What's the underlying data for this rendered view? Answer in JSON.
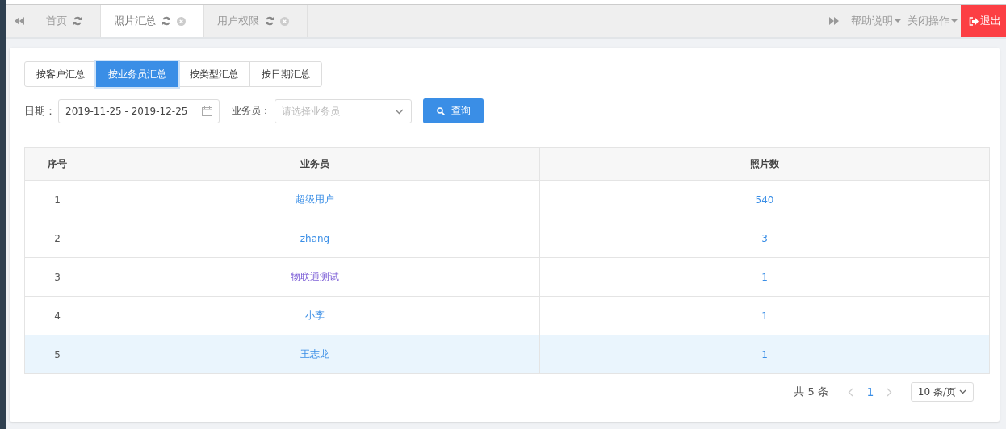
{
  "tabs": [
    {
      "label": "首页",
      "selected": false,
      "closable": false
    },
    {
      "label": "照片汇总",
      "selected": true,
      "closable": true
    },
    {
      "label": "用户权限",
      "selected": false,
      "closable": true
    }
  ],
  "top_actions": [
    {
      "label": "帮助说明"
    },
    {
      "label": "关闭操作"
    }
  ],
  "logout": "退出",
  "group_buttons": [
    {
      "label": "按客户汇总",
      "selected": false
    },
    {
      "label": "按业务员汇总",
      "selected": true
    },
    {
      "label": "按类型汇总",
      "selected": false
    },
    {
      "label": "按日期汇总",
      "selected": false
    }
  ],
  "filters": {
    "date_label": "日期：",
    "date_value": "2019-11-25 - 2019-12-25",
    "salesman_label": "业务员：",
    "salesman_placeholder": "请选择业务员",
    "query_button": "查询"
  },
  "table": {
    "columns": [
      "序号",
      "业务员",
      "照片数"
    ],
    "rows": [
      {
        "cells": [
          "1",
          "超级用户",
          "540"
        ],
        "visited": false,
        "highlighted": false
      },
      {
        "cells": [
          "2",
          "zhang",
          "3"
        ],
        "visited": false,
        "highlighted": false
      },
      {
        "cells": [
          "3",
          "物联通测试",
          "1"
        ],
        "visited": true,
        "highlighted": false
      },
      {
        "cells": [
          "4",
          "小李",
          "1"
        ],
        "visited": false,
        "highlighted": false
      },
      {
        "cells": [
          "5",
          "王志龙",
          "1"
        ],
        "visited": false,
        "highlighted": true
      }
    ]
  },
  "pagination": {
    "total": "共 5 条",
    "pages": [
      {
        "label": "1",
        "selected": true
      }
    ],
    "page_size": "10 条/页"
  }
}
